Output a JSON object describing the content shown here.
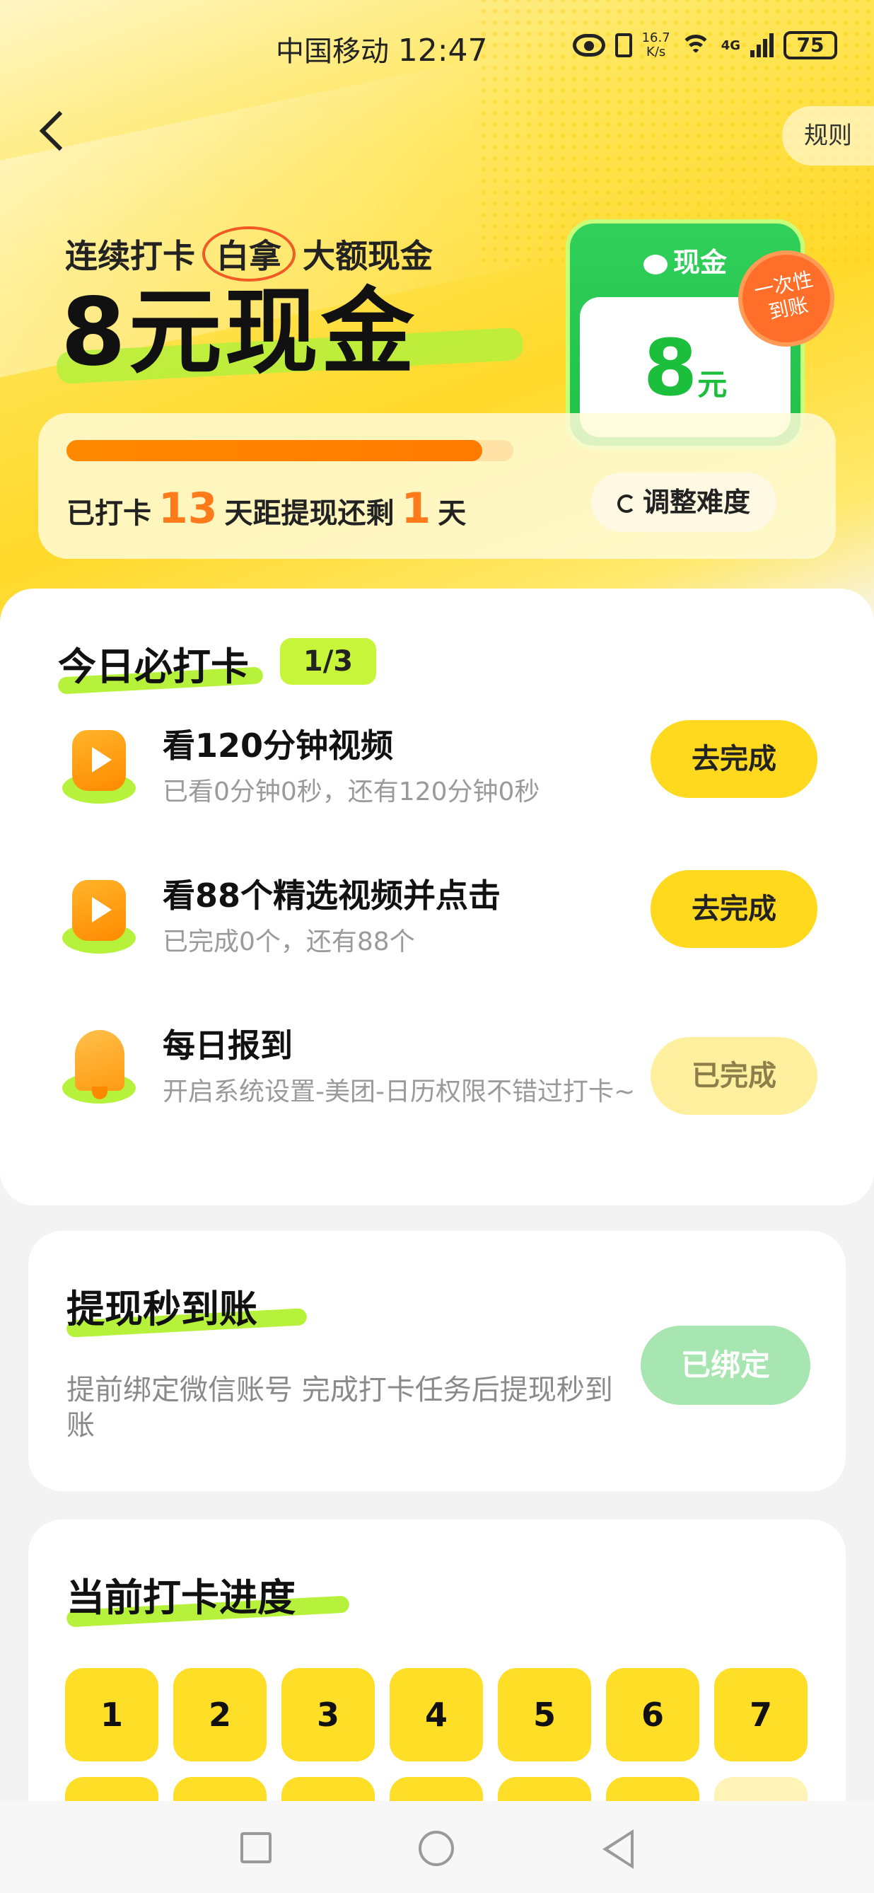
{
  "status_bar": {
    "carrier": "中国移动",
    "time": "12:47",
    "net_speed_value": "16.7",
    "net_speed_unit": "K/s",
    "network_type": "4G",
    "battery": "75"
  },
  "header": {
    "rules_label": "规则"
  },
  "hero": {
    "subtitle_pre": "连续打卡",
    "subtitle_highlight": "白拿",
    "subtitle_post": "大额现金",
    "title": "8元现金",
    "cash_card": {
      "label": "现金",
      "amount": "8",
      "unit": "元",
      "stamp_line1": "一次性",
      "stamp_line2": "到账"
    }
  },
  "progress": {
    "fraction": 0.93,
    "prefix": "已打卡",
    "days_done": "13",
    "middle": "天距提现还剩",
    "days_left": "1",
    "suffix": "天",
    "adjust_label": "调整难度"
  },
  "tasks": {
    "title": "今日必打卡",
    "badge": "1/3",
    "items": [
      {
        "icon": "video-play-icon",
        "title": "看120分钟视频",
        "desc": "已看0分钟0秒，还有120分钟0秒",
        "button": "去完成",
        "done": false
      },
      {
        "icon": "video-play-icon",
        "title": "看88个精选视频并点击",
        "desc": "已完成0个，还有88个",
        "button": "去完成",
        "done": false
      },
      {
        "icon": "bell-icon",
        "title": "每日报到",
        "desc": "开启系统设置-美团-日历权限不错过打卡~",
        "button": "已完成",
        "done": true
      }
    ]
  },
  "withdraw": {
    "title": "提现秒到账",
    "desc": "提前绑定微信账号 完成打卡任务后提现秒到账",
    "button": "已绑定"
  },
  "checkin_progress": {
    "title": "当前打卡进度",
    "days": [
      "1",
      "2",
      "3",
      "4",
      "5",
      "6",
      "7"
    ]
  },
  "colors": {
    "accent_yellow": "#ffd91e",
    "accent_green": "#1fbf48",
    "accent_orange": "#ff7a1a",
    "highlight_lime": "#b6f23c"
  }
}
